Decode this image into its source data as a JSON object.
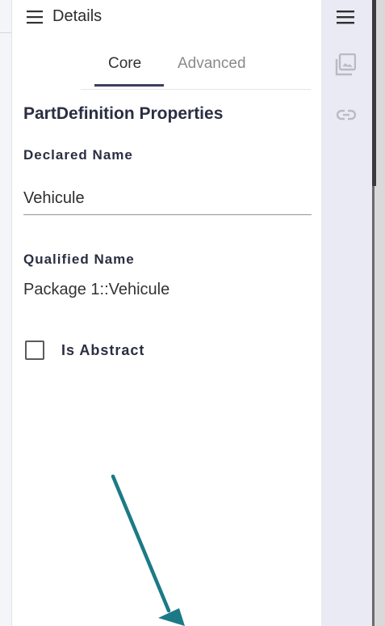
{
  "header": {
    "title": "Details",
    "menu_icon": "hamburger-menu-icon"
  },
  "tabs": [
    {
      "label": "Core",
      "active": true
    },
    {
      "label": "Advanced",
      "active": false
    }
  ],
  "properties": {
    "section_title": "PartDefinition Properties",
    "declared_name_label": "Declared Name",
    "declared_name_value": "Vehicule",
    "qualified_name_label": "Qualified Name",
    "qualified_name_value": "Package 1::Vehicule",
    "is_abstract_label": "Is Abstract",
    "is_abstract_checked": false
  },
  "right_rail": {
    "icons": [
      "hamburger-menu-icon",
      "image-gallery-icon",
      "link-icon"
    ]
  },
  "colors": {
    "accent": "#3b3f5c",
    "rail_background": "#e9eaf3",
    "annotation_arrow": "#1b7a86"
  }
}
